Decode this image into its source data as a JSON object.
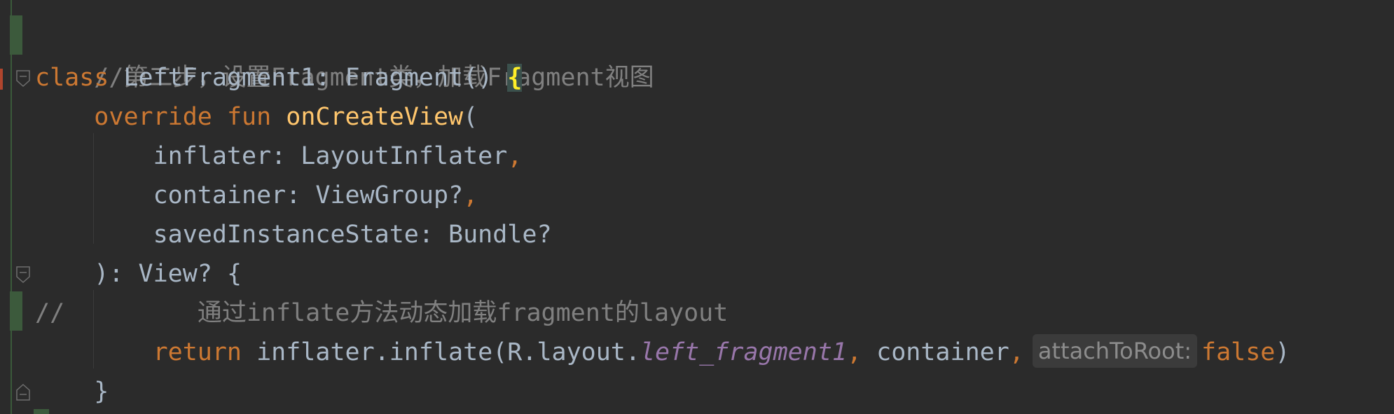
{
  "editor": {
    "lines": [
      {
        "comment": "//第二步，设置Fragment类，加载Fragment视图"
      },
      {
        "kw": "class",
        "name": " LeftFragment1: Fragment() ",
        "brace": "{"
      },
      {
        "kw1": "override",
        "kw2": "fun",
        "fn": "onCreateView",
        "rest": "("
      },
      {
        "param": "inflater: LayoutInflater",
        "comma": ","
      },
      {
        "param": "container: ViewGroup?",
        "comma": ","
      },
      {
        "param": "savedInstanceState: Bundle?"
      },
      {
        "text": "): View? {"
      },
      {
        "slashes": "//",
        "comment": "通过inflate方法动态加载fragment的layout"
      },
      {
        "kw": "return",
        "call": " inflater.inflate(R.layout.",
        "italic": "left_fragment1",
        "comma1": ",",
        "arg": " container",
        "comma2": ",",
        "hint": "attachToRoot:",
        "value": "false",
        "close": ")"
      },
      {
        "text": "}"
      }
    ]
  }
}
